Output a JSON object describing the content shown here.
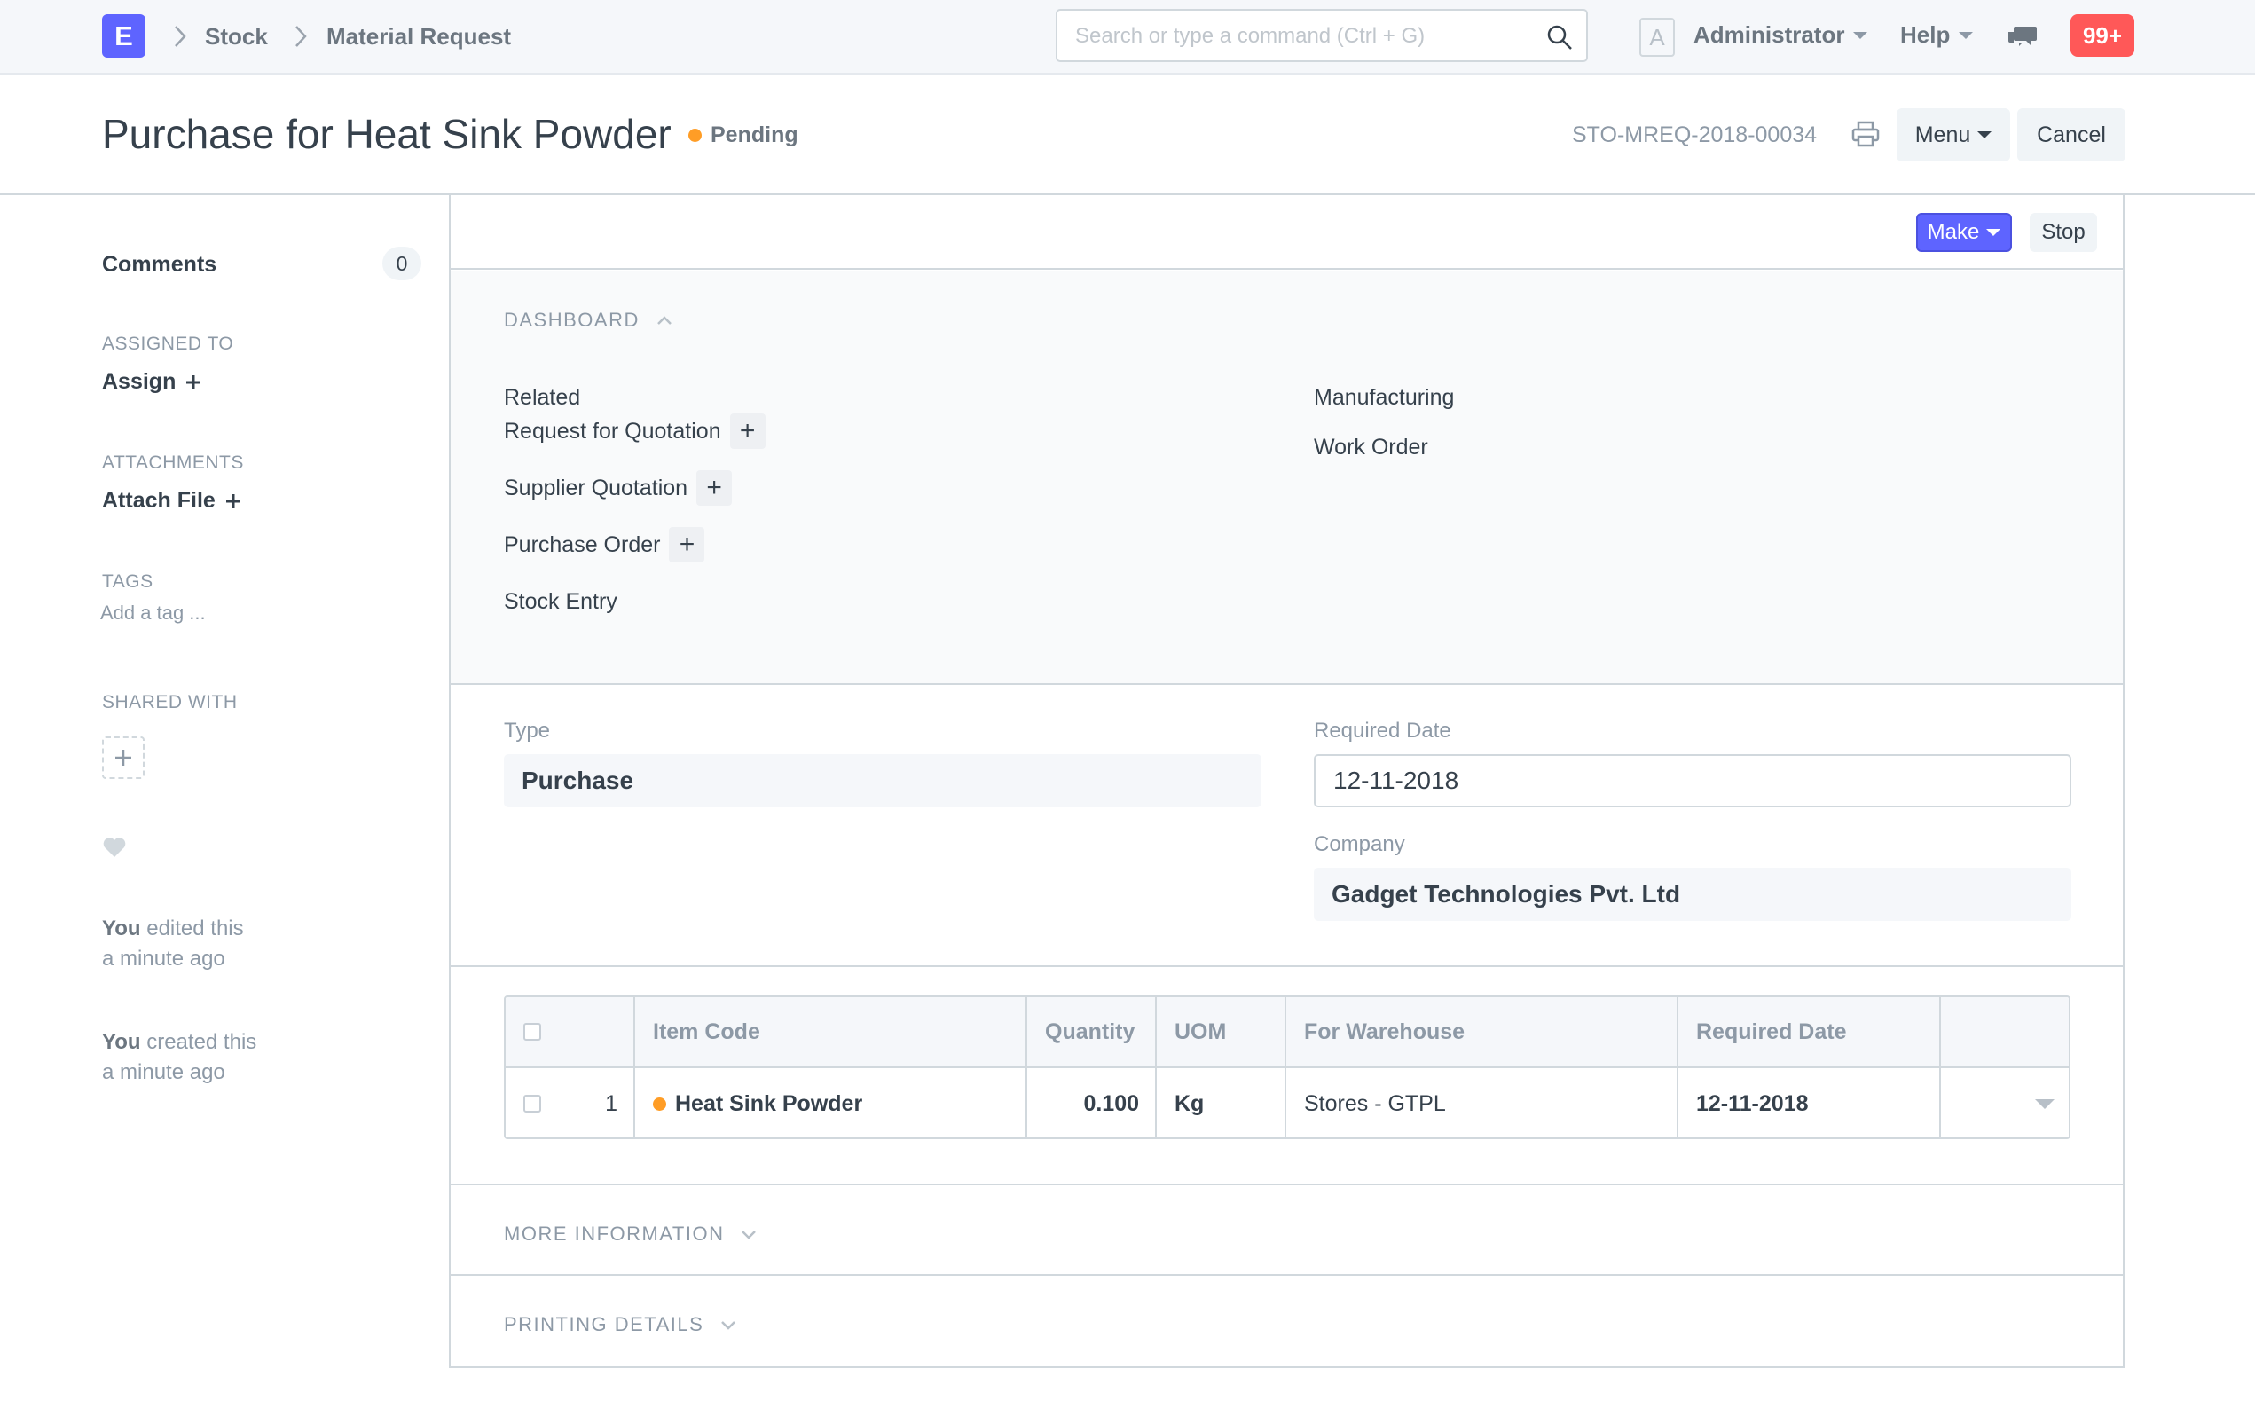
{
  "navbar": {
    "logo_letter": "E",
    "breadcrumbs": [
      "Stock",
      "Material Request"
    ],
    "search_placeholder": "Search or type a command (Ctrl + G)",
    "avatar_letter": "A",
    "user_label": "Administrator",
    "help_label": "Help",
    "notification_count": "99+"
  },
  "page_head": {
    "title": "Purchase for Heat Sink Powder",
    "status": "Pending",
    "status_color": "#ff9d26",
    "doc_name": "STO-MREQ-2018-00034",
    "menu_label": "Menu",
    "cancel_label": "Cancel"
  },
  "sidebar": {
    "comments_label": "Comments",
    "comments_count": "0",
    "assigned_to_label": "ASSIGNED TO",
    "assign_label": "Assign",
    "attachments_label": "ATTACHMENTS",
    "attach_label": "Attach File",
    "tags_label": "TAGS",
    "tag_placeholder": "Add a tag ...",
    "shared_with_label": "SHARED WITH",
    "activity": [
      {
        "who": "You",
        "action": " edited this",
        "when": "a minute ago"
      },
      {
        "who": "You",
        "action": " created this",
        "when": "a minute ago"
      }
    ]
  },
  "toolbar": {
    "make_label": "Make",
    "stop_label": "Stop",
    "accent_color": "#5e64ff"
  },
  "dashboard": {
    "heading": "DASHBOARD",
    "related_title": "Related",
    "related_links": [
      "Request for Quotation",
      "Supplier Quotation",
      "Purchase Order",
      "Stock Entry"
    ],
    "manufacturing_title": "Manufacturing",
    "manufacturing_links": [
      "Work Order"
    ]
  },
  "fields": {
    "type_label": "Type",
    "type_value": "Purchase",
    "required_date_label": "Required Date",
    "required_date_value": "12-11-2018",
    "company_label": "Company",
    "company_value": "Gadget Technologies Pvt. Ltd"
  },
  "items_table": {
    "columns": [
      "Item Code",
      "Quantity",
      "UOM",
      "For Warehouse",
      "Required Date"
    ],
    "rows": [
      {
        "idx": "1",
        "item_code": "Heat Sink Powder",
        "quantity": "0.100",
        "uom": "Kg",
        "warehouse": "Stores - GTPL",
        "required_date": "12-11-2018"
      }
    ]
  },
  "sections": {
    "more_info": "MORE INFORMATION",
    "printing": "PRINTING DETAILS"
  }
}
